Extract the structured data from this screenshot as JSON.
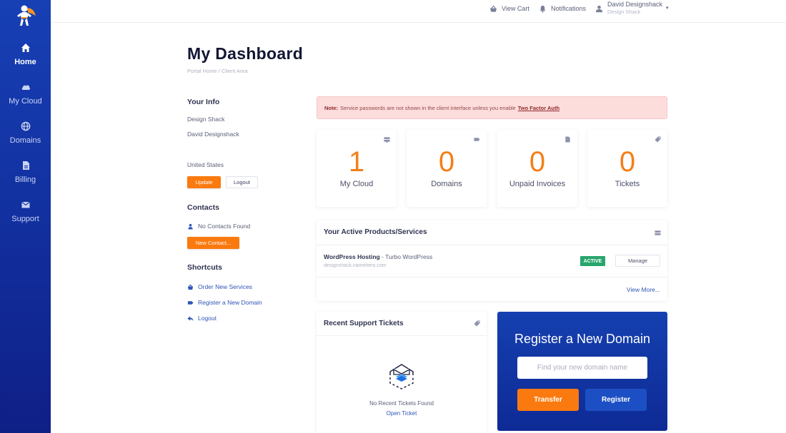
{
  "sidebar": {
    "logo": "namehero-mascot-logo",
    "items": [
      {
        "label": "Home",
        "icon": "home-icon",
        "active": true
      },
      {
        "label": "My Cloud",
        "icon": "cloud-icon",
        "active": false
      },
      {
        "label": "Domains",
        "icon": "globe-icon",
        "active": false
      },
      {
        "label": "Billing",
        "icon": "document-icon",
        "active": false
      },
      {
        "label": "Support",
        "icon": "envelope-icon",
        "active": false
      }
    ]
  },
  "topbar": {
    "cart_label": "View Cart",
    "notifications_label": "Notifications",
    "user_name": "David Designshack",
    "user_company": "Design Shack",
    "caret": "▾"
  },
  "header": {
    "title": "My Dashboard",
    "breadcrumb": [
      "Portal Home",
      "Client Area"
    ],
    "breadcrumb_sep": "/"
  },
  "your_info": {
    "heading": "Your Info",
    "company": "Design Shack",
    "name": "David Designshack",
    "country": "United States",
    "update_label": "Update",
    "logout_label": "Logout"
  },
  "contacts": {
    "heading": "Contacts",
    "empty_text": "No Contacts Found",
    "new_contact_label": "New Contact..."
  },
  "shortcuts": {
    "heading": "Shortcuts",
    "items": [
      {
        "label": "Order New Services",
        "icon": "basket-icon"
      },
      {
        "label": "Register a New Domain",
        "icon": "tag-icon"
      },
      {
        "label": "Logout",
        "icon": "back-arrow-icon"
      }
    ]
  },
  "alert": {
    "prefix": "Note:",
    "text": "Service passwords are not shown in the client interface unless you enable",
    "link": "Two Factor Auth"
  },
  "stats": [
    {
      "value": "1",
      "label": "My Cloud",
      "icon": "server-icon"
    },
    {
      "value": "0",
      "label": "Domains",
      "icon": "tag-icon"
    },
    {
      "value": "0",
      "label": "Unpaid Invoices",
      "icon": "document-icon"
    },
    {
      "value": "0",
      "label": "Tickets",
      "icon": "ticket-icon"
    }
  ],
  "products": {
    "heading": "Your Active Products/Services",
    "items": [
      {
        "name": "WordPress Hosting",
        "separator": " - ",
        "plan": "Turbo WordPress",
        "domain": "designshack.namehero.com",
        "status": "ACTIVE",
        "action": "Manage"
      }
    ],
    "view_more": "View More..."
  },
  "tickets": {
    "heading": "Recent Support Tickets",
    "empty_text": "No Recent Tickets Found",
    "open_link": "Open Ticket"
  },
  "domain_register": {
    "title": "Register a New Domain",
    "placeholder": "Find your new domain name",
    "value": "",
    "transfer_label": "Transfer",
    "register_label": "Register"
  },
  "colors": {
    "sidebar_blue": "#1740b5",
    "accent_orange": "#fb7a0f",
    "stat_orange": "#f47f17",
    "active_green": "#27a56b",
    "link_blue": "#2f55b6",
    "alert_bg": "#fddcdc"
  }
}
